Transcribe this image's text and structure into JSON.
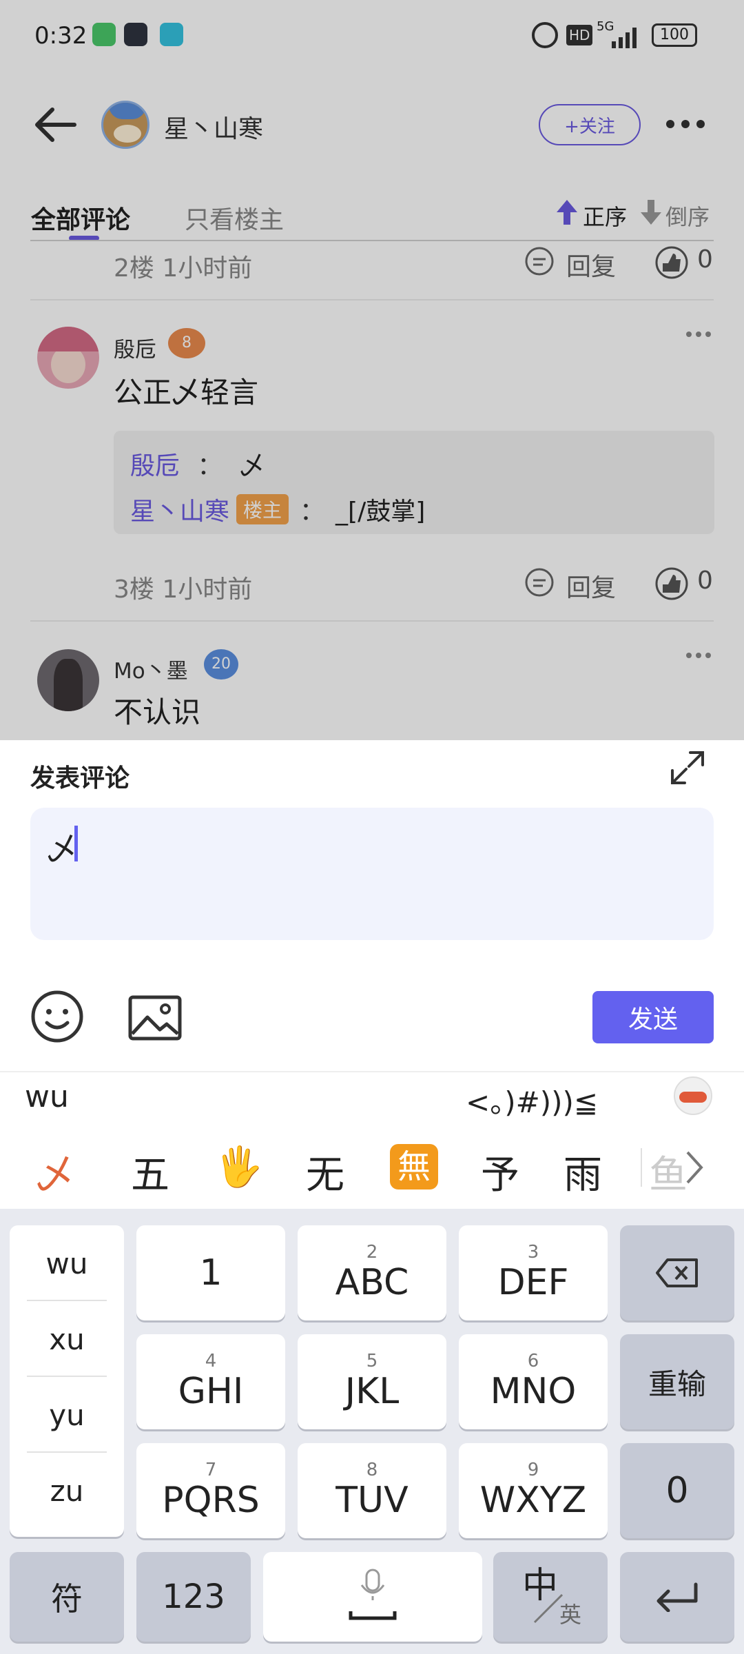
{
  "status_bar": {
    "time": "0:32",
    "network": "5G",
    "battery": "100",
    "hd": "HD"
  },
  "header": {
    "username": "星丶山寒",
    "follow_label": "+关注"
  },
  "tabs": {
    "all": "全部评论",
    "op_only": "只看楼主",
    "asc": "正序",
    "desc": "倒序"
  },
  "floor2": {
    "meta": "2楼  1小时前",
    "reply": "回复",
    "likes": "0"
  },
  "comment1": {
    "name": "殷卮",
    "level": "8",
    "text": "公正乄轻言",
    "quote": [
      {
        "name": "殷卮",
        "sep": "：",
        "text": "乄"
      },
      {
        "name": "星丶山寒",
        "badge": "楼主",
        "sep": "：",
        "text": "_[/鼓掌]"
      }
    ]
  },
  "floor3": {
    "meta": "3楼  1小时前",
    "reply": "回复",
    "likes": "0"
  },
  "comment2": {
    "name": "Mo丶墨",
    "level": "20",
    "text": "不认识"
  },
  "compose": {
    "title": "发表评论",
    "input_value": "乄",
    "send_label": "发送"
  },
  "ime": {
    "pinyin": "wu",
    "emoticon": "<。)#)))≦",
    "candidates": [
      "乄",
      "五",
      "🖐",
      "无",
      "無",
      "予",
      "雨",
      "鱼"
    ],
    "py_options": [
      "wu",
      "xu",
      "yu",
      "zu"
    ],
    "keys": [
      {
        "n": "",
        "l": "1"
      },
      {
        "n": "2",
        "l": "ABC"
      },
      {
        "n": "3",
        "l": "DEF"
      },
      {
        "n": "4",
        "l": "GHI"
      },
      {
        "n": "5",
        "l": "JKL"
      },
      {
        "n": "6",
        "l": "MNO"
      },
      {
        "n": "7",
        "l": "PQRS"
      },
      {
        "n": "8",
        "l": "TUV"
      },
      {
        "n": "9",
        "l": "WXYZ"
      }
    ],
    "reinput": "重输",
    "zero": "0",
    "symbol": "符",
    "num": "123",
    "lang_main": "中",
    "lang_sub": "英",
    "accent": "#6361ef"
  }
}
